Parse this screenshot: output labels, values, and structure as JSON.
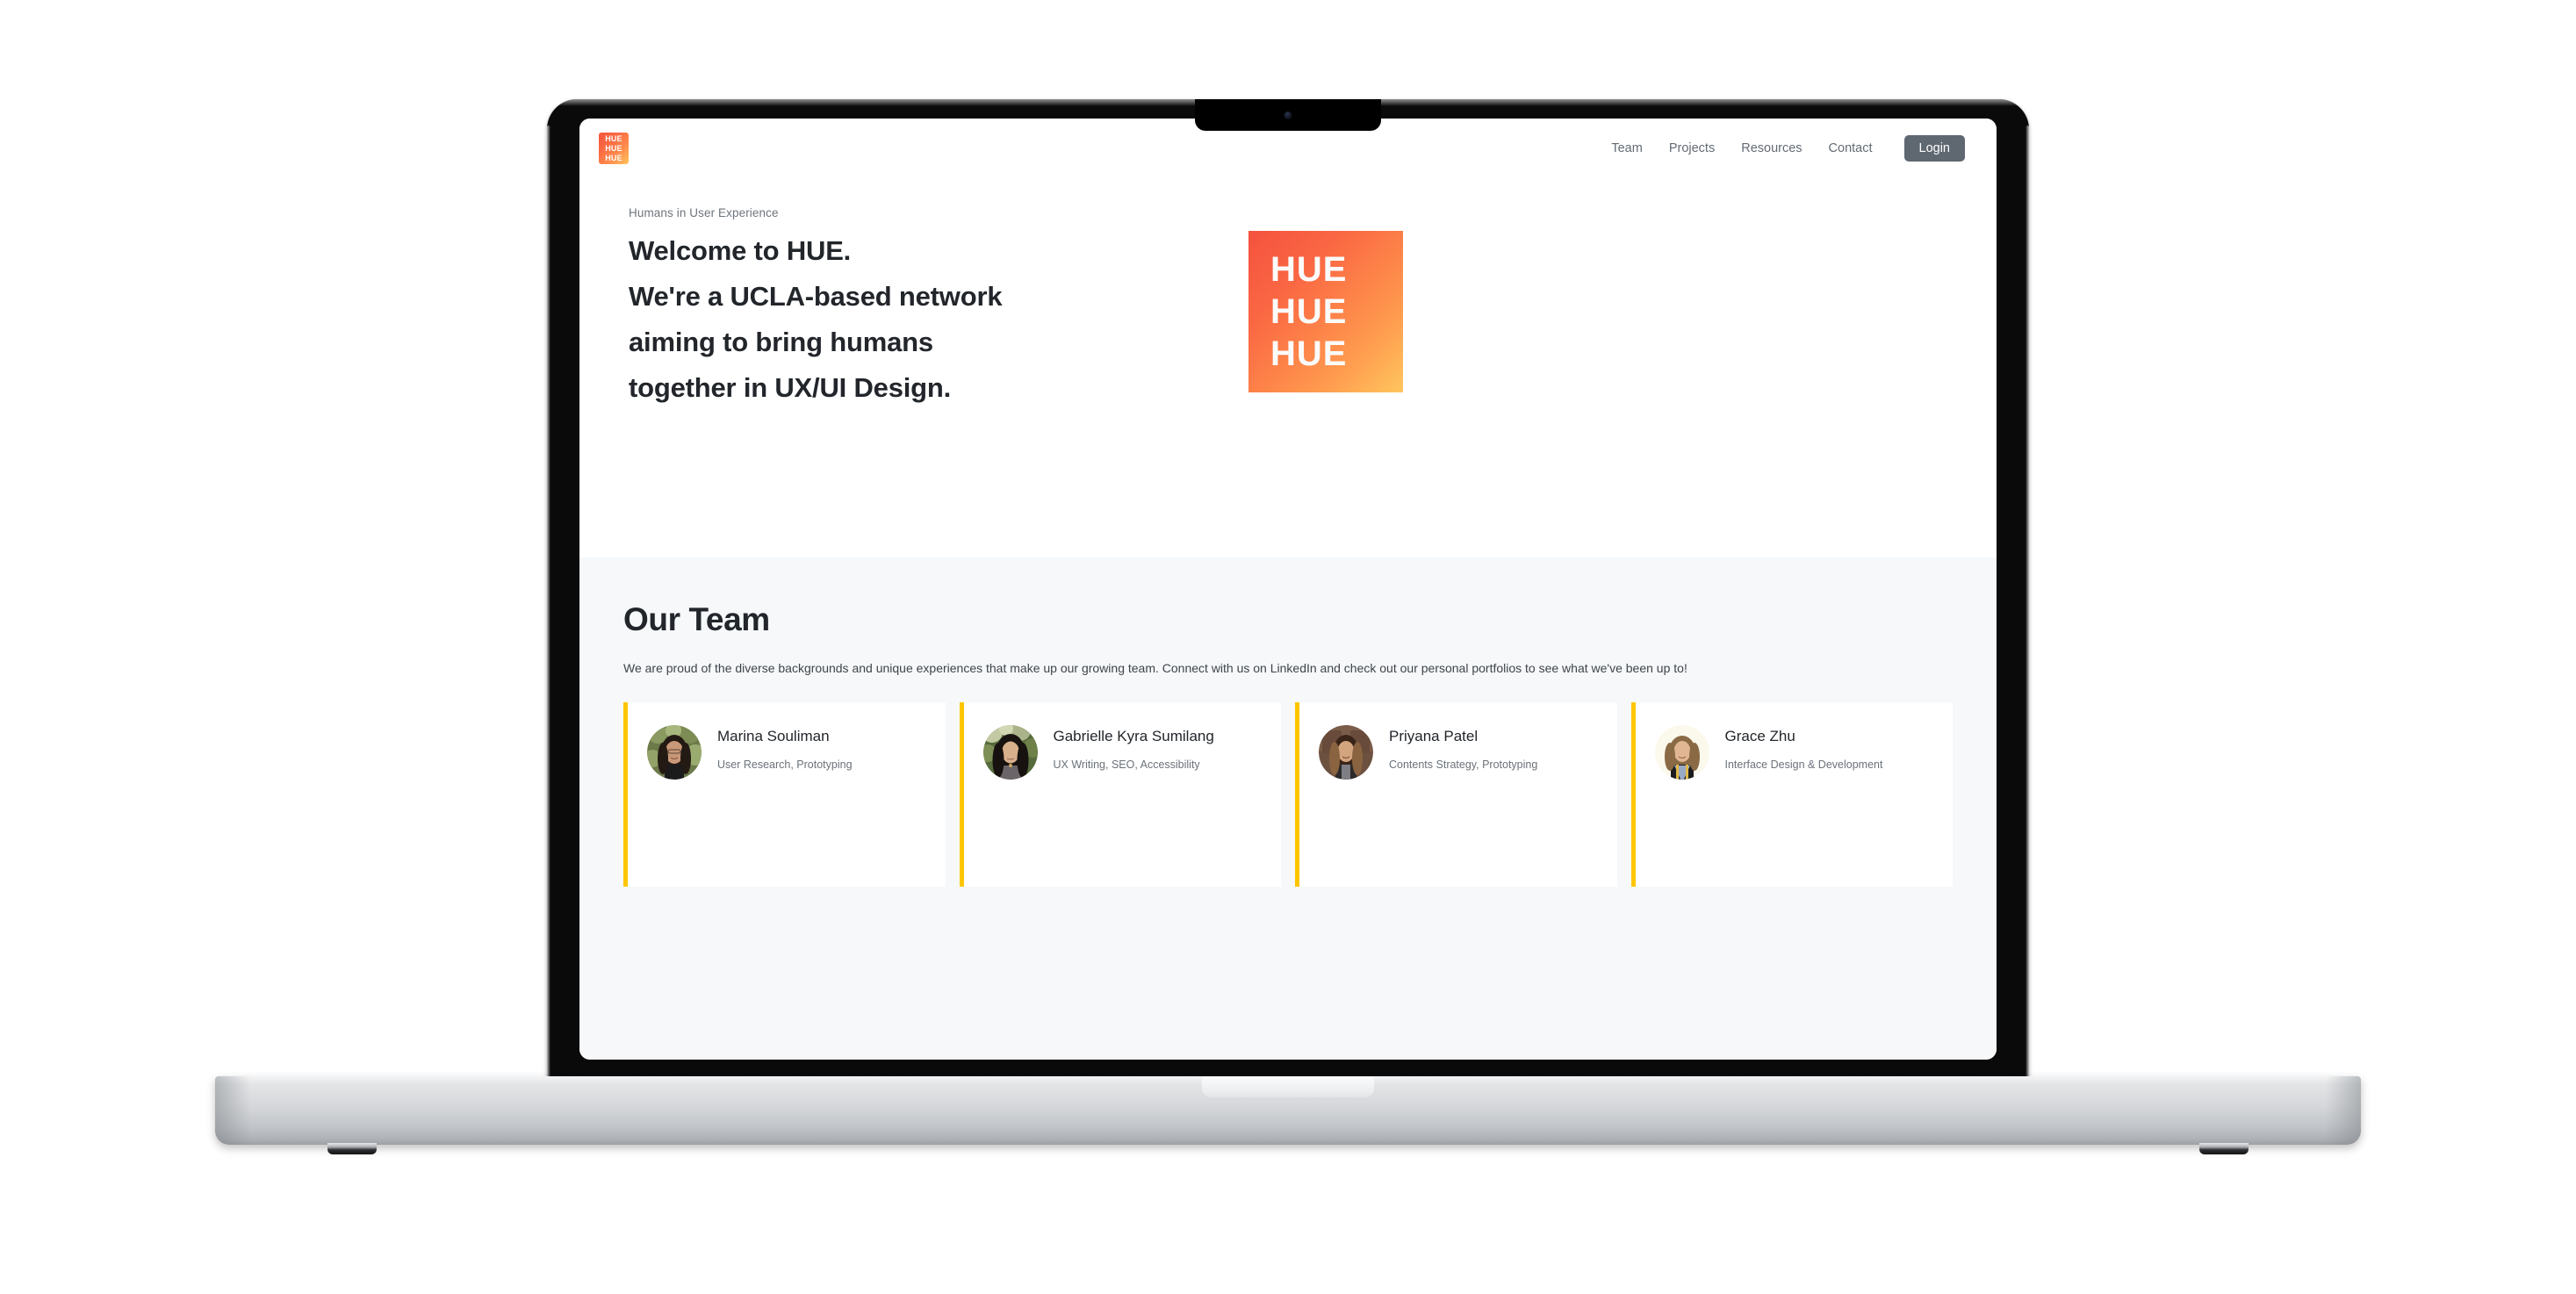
{
  "header": {
    "logo_lines": [
      "HUE",
      "HUE",
      "HUE"
    ],
    "nav": [
      {
        "label": "Team"
      },
      {
        "label": "Projects"
      },
      {
        "label": "Resources"
      },
      {
        "label": "Contact"
      }
    ],
    "login_label": "Login"
  },
  "hero": {
    "eyebrow": "Humans in User Experience",
    "title_lines": [
      "Welcome to HUE.",
      "We're a UCLA-based network",
      "aiming to bring humans",
      "together in UX/UI Design."
    ],
    "art_lines": [
      "HUE",
      "HUE",
      "HUE"
    ]
  },
  "team": {
    "title": "Our Team",
    "description": "We are proud of the diverse backgrounds and unique experiences that make up our growing team. Connect with us on LinkedIn and check out our personal portfolios to see what we've been up to!",
    "members": [
      {
        "name": "Marina Souliman",
        "role": "User Research, Prototyping",
        "avatar": "portrait-marina"
      },
      {
        "name": "Gabrielle Kyra Sumilang",
        "role": "UX Writing, SEO, Accessibility",
        "avatar": "portrait-gabrielle"
      },
      {
        "name": "Priyana Patel",
        "role": "Contents Strategy, Prototyping",
        "avatar": "portrait-priyana"
      },
      {
        "name": "Grace Zhu",
        "role": "Interface Design & Development",
        "avatar": "portrait-grace"
      }
    ]
  },
  "colors": {
    "accent_yellow": "#FFC600",
    "brand_gradient_start": "#F4523F",
    "brand_gradient_end": "#FFC65E",
    "login_button": "#5F6771",
    "section_background": "#F6F8FA",
    "text_dark": "#22262B"
  }
}
